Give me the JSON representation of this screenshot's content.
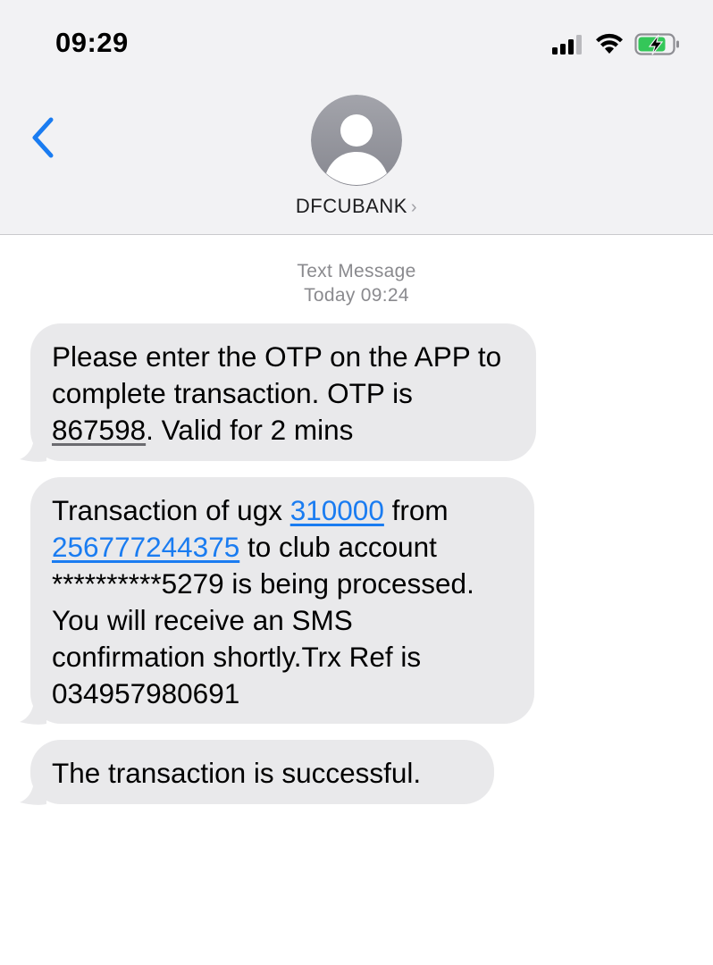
{
  "status_bar": {
    "time": "09:29"
  },
  "contact": {
    "name": "DFCUBANK",
    "chevron": "›"
  },
  "thread_meta": {
    "type": "Text Message",
    "timestamp": "Today 09:24"
  },
  "messages": [
    {
      "part1": "Please enter the OTP on the APP to complete transaction. OTP is ",
      "otp": "867598",
      "part2": ". Valid for 2 mins"
    },
    {
      "part1": "Transaction of ugx ",
      "amount": "310000",
      "part2": " from ",
      "phone": "256777244375",
      "part3": " to club account **********5279 is being processed. You will receive an SMS confirmation shortly.Trx Ref is 034957980691"
    },
    {
      "text": "The transaction is successful."
    }
  ],
  "colors": {
    "header_bg": "#f2f2f4",
    "bubble_bg": "#e9e9eb",
    "link": "#1a7cf1",
    "accent": "#1a7cf1",
    "battery_green": "#34c759"
  },
  "icons": [
    "back-chevron-icon",
    "signal-icon",
    "wifi-icon",
    "battery-charging-icon",
    "person-avatar-icon"
  ]
}
